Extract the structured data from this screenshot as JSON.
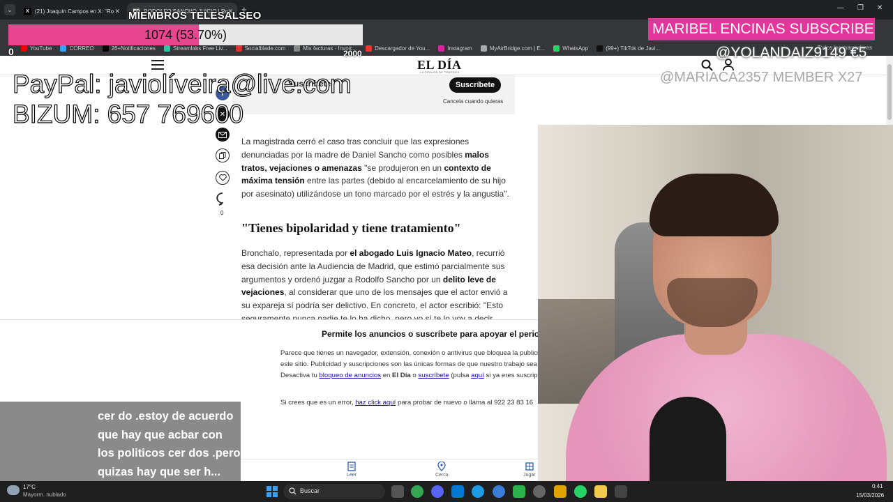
{
  "browser": {
    "tabs": [
      {
        "label": "(21) Joaquín Campos en X: \"Ro",
        "favicon": "X"
      },
      {
        "label": "RODOLFO SANCHO JUICIO | Ro",
        "favicon": "ED"
      }
    ],
    "bookmarks": [
      "YouTube",
      "CORREO",
      "26+Notificaciones",
      "Streamlabs Free Liv...",
      "Socialblade.com",
      "Mis facturas - Invoic...",
      "Descargador de You...",
      "Instagram",
      "MyAirBridge.com | E...",
      "WhatsApp",
      "(99+) TikTok de Javi..."
    ],
    "bookmarks_right": "Todos los marcadores"
  },
  "site": {
    "logo": "EL DÍA",
    "logo_sub": "LA OPINIÓN DE TENERIFE"
  },
  "subscribe": {
    "text": "Suscríbete",
    "button": "Suscríbete",
    "note": "Cancela cuando quieras"
  },
  "share": {
    "comment_count": "0"
  },
  "article": {
    "p1": [
      "La magistrada cerró el caso tras concluir que las expresiones denunciadas por la madre de Daniel Sancho como posibles ",
      "malos tratos, vejaciones o amenazas",
      " \"se produjeron en un ",
      "contexto de máxima tensión",
      " entre las partes (debido al encarcelamiento de su hijo por asesinato) utilizándose un tono marcado por el estrés y la angustia\"."
    ],
    "h2": "\"Tienes bipolaridad y tiene tratamiento\"",
    "p2": [
      "Bronchalo, representada por ",
      "el abogado Luis Ignacio Mateo",
      ", recurrió esa decisión ante la Audiencia de Madrid, que estimó parcialmente sus argumentos y ordenó juzgar a Rodolfo Sancho por un ",
      "delito leve de vejaciones",
      ", al considerar que uno de los mensajes que el actor envió a su expareja sí podría ser delictivo. En concreto, el actor escribió: \"Esto seguramente nunca nadie te lo ha dicho, pero yo sí te lo voy a decir."
    ]
  },
  "adblock": {
    "title": "Permite los anuncios o suscríbete para apoyar el periodismo",
    "body_1": "Parece que tienes un navegador, extensión, conexión o antivirus que bloquea la publicidad de este sitio. Publicidad y suscripciones son las únicas formas de que nuestro trabajo sea posible. Desactiva tu ",
    "body_link1": "bloqueo de anuncios",
    "body_2": " en ",
    "body_brand": "El Día",
    "body_3": " o ",
    "body_link2": "suscríbete",
    "body_4": " (pulsa ",
    "body_link3": "aquí",
    "body_5": " si ya eres suscriptor).",
    "err_1": "Si crees que es un error, ",
    "err_link": "haz click aquí",
    "err_2": " para probar de nuevo o llama al 922 23 83 16"
  },
  "appbar": {
    "items": [
      "Leer",
      "Cerca",
      "Jugar"
    ]
  },
  "overlay": {
    "members_label": "MIEMBROS TELESALSEO",
    "goal": {
      "text": "1074 (53.70%)",
      "progress": 0.537,
      "min": "0",
      "max": "2000"
    },
    "sub_alert": "MARIBEL ENCINAS  SUBSCRIBER",
    "donation": "@YOLANDAIZ9149  €5",
    "membership": "@MARIACA2357  MEMBER X27",
    "paypal": "PayPal: javiolíveira@live.com",
    "bizum": "BIZUM: 657 769600",
    "chat": "cer do .estoy de acuerdo que hay que acbar con los politicos cer dos .pero quizas hay que ser h..."
  },
  "taskbar": {
    "weather_temp": "17°C",
    "weather_desc": "Mayorm. nublado",
    "search": "Buscar",
    "time": "0:41",
    "date": "15/03/2026"
  },
  "colors": {
    "accent_pink": "#e2369a",
    "goal_fill": "#e8468f",
    "link": "#1a0dab"
  }
}
